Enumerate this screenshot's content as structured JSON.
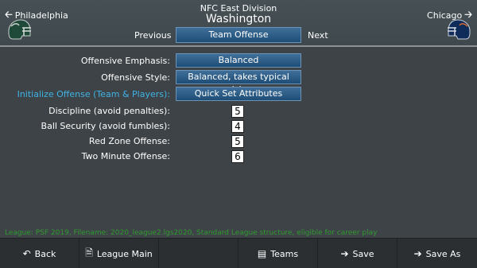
{
  "header": {
    "division": "NFC East Division",
    "team": "Washington",
    "prev_team": "Philadelphia",
    "next_team": "Chicago",
    "previous_label": "Previous",
    "next_label": "Next",
    "page_tab": "Team Offense",
    "prev_team_color": "#1f4a3a",
    "next_team_color": "#0f2b5a"
  },
  "form": {
    "offensive_emphasis_label": "Offensive Emphasis:",
    "offensive_emphasis_value": "Balanced",
    "offensive_style_label": "Offensive Style:",
    "offensive_style_value": "Balanced, takes typical risks",
    "initialize_label": "Initialize Offense (Team & Players):",
    "initialize_button": "Quick Set Attributes",
    "discipline_label": "Discipline (avoid penalties):",
    "discipline_value": "5",
    "ball_security_label": "Ball Security (avoid fumbles):",
    "ball_security_value": "4",
    "red_zone_label": "Red Zone Offense:",
    "red_zone_value": "5",
    "two_minute_label": "Two Minute Offense:",
    "two_minute_value": "6"
  },
  "status_text": "League: PSF 2019,  Filename: 2020_league2.lgs2020,  Standard League structure, eligible for career play",
  "footer": {
    "back": "Back",
    "league_main": "League Main",
    "teams": "Teams",
    "save": "Save",
    "save_as": "Save As"
  },
  "colors": {
    "accent_button": "#2a5a86",
    "link": "#3fb4e4",
    "status": "#2f9a2f"
  }
}
